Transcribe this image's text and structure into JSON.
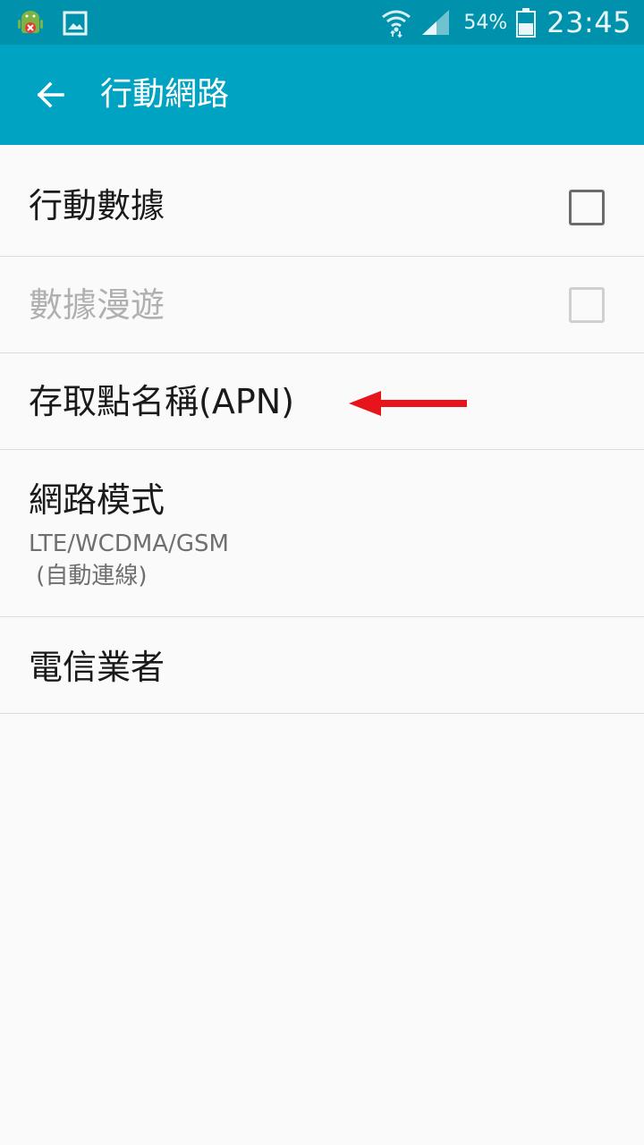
{
  "status_bar": {
    "left_icons": [
      "android-debug-icon",
      "gallery-icon"
    ],
    "right_icons": [
      "wifi-icon",
      "signal-icon",
      "battery-icon"
    ],
    "battery_percent": "54%",
    "time": "23:45"
  },
  "app_bar": {
    "back_icon": "arrow-back-icon",
    "title": "行動網路"
  },
  "settings": [
    {
      "label": "行動數據",
      "checkbox": true,
      "checked": false,
      "enabled": true
    },
    {
      "label": "數據漫遊",
      "checkbox": true,
      "checked": false,
      "enabled": false
    },
    {
      "label": "存取點名稱(APN)",
      "checkbox": false,
      "annotation": "red-arrow-icon"
    },
    {
      "label": "網路模式",
      "sub_line1": "LTE/WCDMA/GSM",
      "sub_line2": " (自動連線)"
    },
    {
      "label": "電信業者"
    }
  ],
  "colors": {
    "status_bar": "#0092ad",
    "app_bar": "#00a3c2",
    "background": "#fafafa",
    "annotation_arrow": "#e8141b"
  }
}
